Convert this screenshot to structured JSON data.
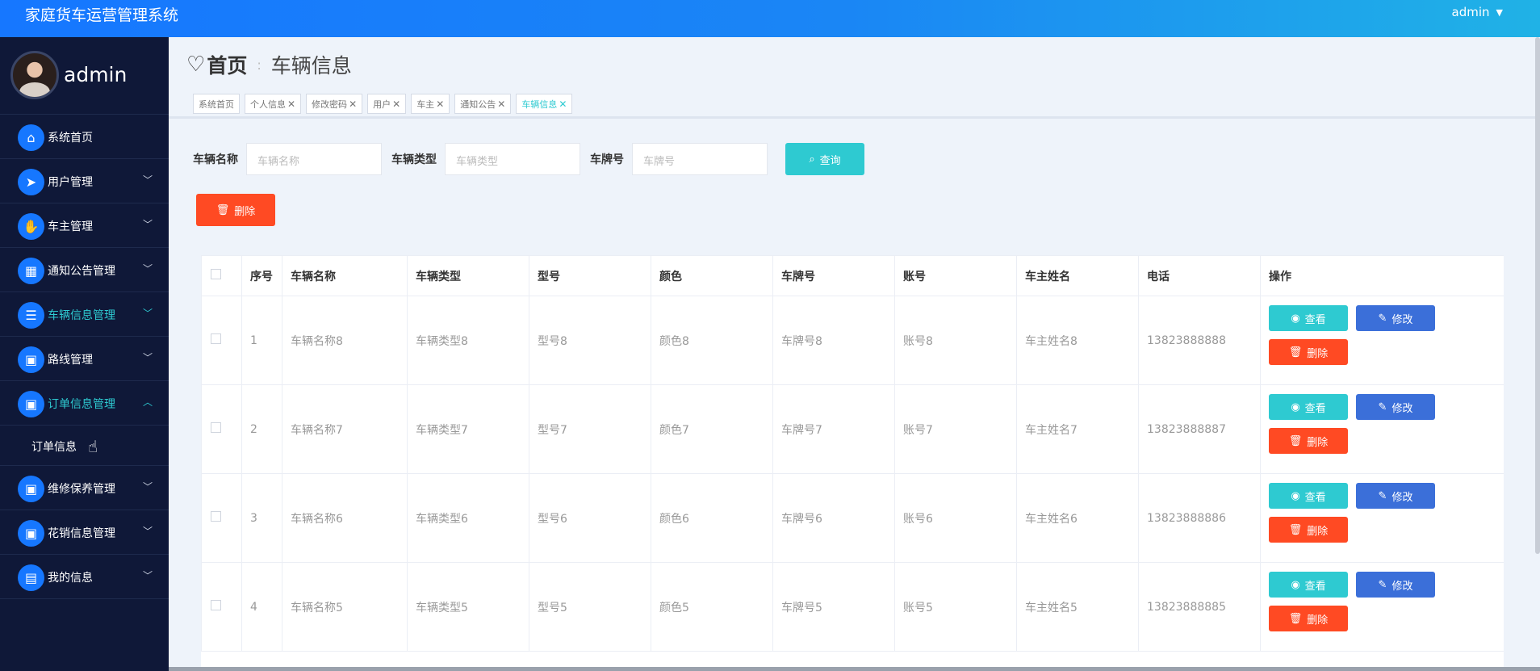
{
  "app": {
    "title": "家庭货车运营管理系统",
    "user": "admin"
  },
  "profile": {
    "name": "admin"
  },
  "sidebar": {
    "items": [
      {
        "label": "系统首页",
        "icon": "home-icon",
        "glyph": "⌂",
        "chev": ""
      },
      {
        "label": "用户管理",
        "icon": "send-icon",
        "glyph": "➤",
        "chev": "﹀"
      },
      {
        "label": "车主管理",
        "icon": "thumb-icon",
        "glyph": "✋",
        "chev": "﹀"
      },
      {
        "label": "通知公告管理",
        "icon": "grid-icon",
        "glyph": "▦",
        "chev": "﹀"
      },
      {
        "label": "车辆信息管理",
        "icon": "sliders-icon",
        "glyph": "☰",
        "chev": "﹀"
      },
      {
        "label": "路线管理",
        "icon": "apps-icon",
        "glyph": "▣",
        "chev": "﹀"
      },
      {
        "label": "订单信息管理",
        "icon": "apps-icon",
        "glyph": "▣",
        "chev": "︿"
      }
    ],
    "sub": {
      "label": "订单信息"
    },
    "items2": [
      {
        "label": "维修保养管理",
        "icon": "apps-icon",
        "glyph": "▣",
        "chev": "﹀"
      },
      {
        "label": "花销信息管理",
        "icon": "apps-icon",
        "glyph": "▣",
        "chev": "﹀"
      },
      {
        "label": "我的信息",
        "icon": "wallet-icon",
        "glyph": "▤",
        "chev": "﹀"
      }
    ]
  },
  "header": {
    "home": "首页",
    "sep": ":",
    "current": "车辆信息"
  },
  "tags": [
    {
      "label": "系统首页",
      "closable": false
    },
    {
      "label": "个人信息",
      "closable": true
    },
    {
      "label": "修改密码",
      "closable": true
    },
    {
      "label": "用户",
      "closable": true
    },
    {
      "label": "车主",
      "closable": true
    },
    {
      "label": "通知公告",
      "closable": true
    },
    {
      "label": "车辆信息",
      "closable": true
    }
  ],
  "search": {
    "name_label": "车辆名称",
    "name_placeholder": "车辆名称",
    "type_label": "车辆类型",
    "type_placeholder": "车辆类型",
    "plate_label": "车牌号",
    "plate_placeholder": "车牌号",
    "query_label": "查询"
  },
  "delete_label": "删除",
  "table": {
    "headers": [
      "序号",
      "车辆名称",
      "车辆类型",
      "型号",
      "颜色",
      "车牌号",
      "账号",
      "车主姓名",
      "电话",
      "操作"
    ],
    "rows": [
      [
        "1",
        "车辆名称8",
        "车辆类型8",
        "型号8",
        "颜色8",
        "车牌号8",
        "账号8",
        "车主姓名8",
        "13823888888"
      ],
      [
        "2",
        "车辆名称7",
        "车辆类型7",
        "型号7",
        "颜色7",
        "车牌号7",
        "账号7",
        "车主姓名7",
        "13823888887"
      ],
      [
        "3",
        "车辆名称6",
        "车辆类型6",
        "型号6",
        "颜色6",
        "车牌号6",
        "账号6",
        "车主姓名6",
        "13823888886"
      ],
      [
        "4",
        "车辆名称5",
        "车辆类型5",
        "型号5",
        "颜色5",
        "车牌号5",
        "账号5",
        "车主姓名5",
        "13823888885"
      ]
    ],
    "view_label": "查看",
    "edit_label": "修改",
    "del_label": "删除"
  }
}
